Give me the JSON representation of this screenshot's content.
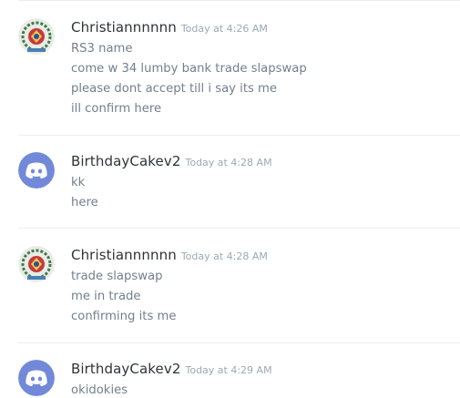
{
  "messages": [
    {
      "author": "Christiannnnnn",
      "timestamp": "Today at 4:26 AM",
      "avatar": "flag-avatar-icon",
      "lines": [
        "RS3 name",
        "come w 34 lumby bank trade slapswap",
        "please dont accept till i say its me",
        "ill confirm here"
      ]
    },
    {
      "author": "BirthdayCakev2",
      "timestamp": "Today at 4:28 AM",
      "avatar": "discord-logo-avatar-icon",
      "lines": [
        "kk",
        "here"
      ]
    },
    {
      "author": "Christiannnnnn",
      "timestamp": "Today at 4:28 AM",
      "avatar": "flag-avatar-icon",
      "lines": [
        "trade slapswap",
        "me in trade",
        "confirming its me"
      ]
    },
    {
      "author": "BirthdayCakev2",
      "timestamp": "Today at 4:29 AM",
      "avatar": "discord-logo-avatar-icon",
      "lines": [
        "okidokies"
      ]
    }
  ],
  "colors": {
    "discord_blurple": "#7289da",
    "username": "#2e3338",
    "message_text": "#737f8d",
    "timestamp": "#99aab5"
  }
}
